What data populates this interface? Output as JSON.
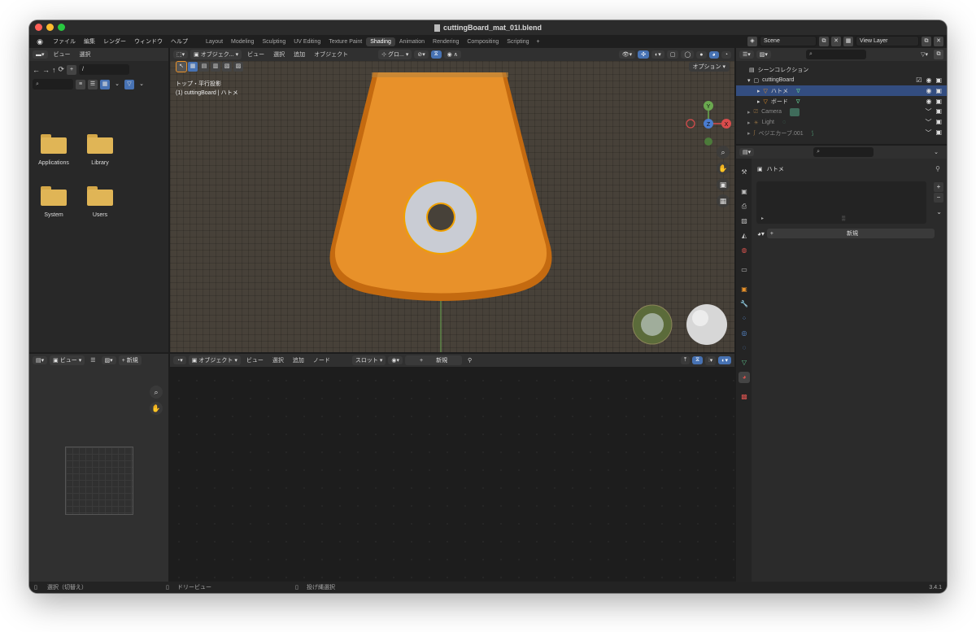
{
  "window": {
    "title": "cuttingBoard_mat_01l.blend"
  },
  "menu": {
    "items": [
      "ファイル",
      "編集",
      "レンダー",
      "ウィンドウ",
      "ヘルプ"
    ],
    "workspaces": [
      "Layout",
      "Modeling",
      "Sculpting",
      "UV Editing",
      "Texture Paint",
      "Shading",
      "Animation",
      "Rendering",
      "Compositing",
      "Scripting"
    ],
    "active_workspace": "Shading",
    "add_workspace": "+",
    "scene": "Scene",
    "view_layer": "View Layer"
  },
  "file_browser": {
    "header": {
      "view": "ビュー",
      "select": "選択"
    },
    "path": "/",
    "folders": [
      "Applications",
      "Library",
      "System",
      "Users"
    ]
  },
  "viewport": {
    "header": {
      "mode": "オブジェク...",
      "view": "ビュー",
      "select": "選択",
      "add": "追加",
      "object": "オブジェクト",
      "transform": "グロ...",
      "options": "オプション"
    },
    "info_line1": "トップ・平行投影",
    "info_line2": "(1) cuttingBoard | ハトメ",
    "gizmo_labels": {
      "x": "X",
      "y": "Y",
      "z": "Z"
    },
    "colors": {
      "board": "#e8912a",
      "board_edge": "#c46a10",
      "ring": "#c9ccd4"
    }
  },
  "image_editor": {
    "header": {
      "view": "ビュー",
      "new": "新規"
    }
  },
  "node_editor": {
    "header": {
      "mode": "オブジェクト",
      "view": "ビュー",
      "select": "選択",
      "add": "追加",
      "node": "ノード",
      "slot": "スロット",
      "new": "新規"
    }
  },
  "outliner": {
    "title": "シーンコレクション",
    "rows": [
      {
        "name": "cuttingBoard",
        "level": 1
      },
      {
        "name": "ハトメ",
        "level": 2,
        "selected": true
      },
      {
        "name": "ボード",
        "level": 2
      },
      {
        "name": "Camera",
        "level": 1,
        "dim": true
      },
      {
        "name": "Light",
        "level": 1,
        "dim": true
      },
      {
        "name": "ベジエカーブ.001",
        "level": 1,
        "dim": true
      }
    ]
  },
  "properties": {
    "object_name": "ハトメ",
    "new_button": "新規",
    "plus": "+",
    "minus": "−"
  },
  "status": {
    "left": "選択（切替え）",
    "mid": "ドリービュー",
    "right": "投げ縄選択",
    "version": "3.4.1"
  }
}
